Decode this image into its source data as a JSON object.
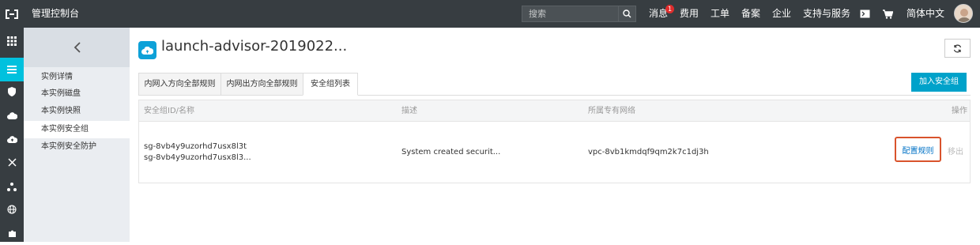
{
  "header": {
    "app_title": "管理控制台",
    "search_placeholder": "搜索",
    "nav": [
      {
        "label": "消息",
        "badge": "1"
      },
      {
        "label": "费用"
      },
      {
        "label": "工单"
      },
      {
        "label": "备案"
      },
      {
        "label": "企业"
      },
      {
        "label": "支持与服务"
      },
      {
        "label": "简体中文"
      }
    ]
  },
  "rail": {
    "icons": [
      "grid-icon",
      "list-icon",
      "shield-icon",
      "cloud-icon",
      "cloud-upload-icon",
      "cross-arrows-icon",
      "cluster-icon",
      "globe-icon",
      "puzzle-icon"
    ],
    "active_index": 1
  },
  "sidebar": {
    "items": [
      {
        "label": "实例详情"
      },
      {
        "label": "本实例磁盘"
      },
      {
        "label": "本实例快照"
      },
      {
        "label": "本实例安全组"
      },
      {
        "label": "本实例安全防护"
      }
    ],
    "active_index": 3
  },
  "main": {
    "title": "launch-advisor-2019022...",
    "tabs": [
      {
        "label": "内网入方向全部规则"
      },
      {
        "label": "内网出方向全部规则"
      },
      {
        "label": "安全组列表"
      }
    ],
    "active_tab": 2,
    "add_button": "加入安全组",
    "table": {
      "headers": [
        "安全组ID/名称",
        "描述",
        "所属专有网络",
        "操作"
      ],
      "rows": [
        {
          "id": "sg-8vb4y9uzorhd7usx8l3t",
          "name": "sg-8vb4y9uzorhd7usx8l3...",
          "description": "System created securit...",
          "vpc": "vpc-8vb1kmdqf9qm2k7c1dj3h",
          "action_primary": "配置规则",
          "action_secondary": "移出"
        }
      ]
    }
  },
  "colors": {
    "topbar": "#373d41",
    "rail_active": "#00c1de",
    "primary_button": "#00a2ca",
    "highlight_box": "#d9532c",
    "link": "#0072c6"
  }
}
